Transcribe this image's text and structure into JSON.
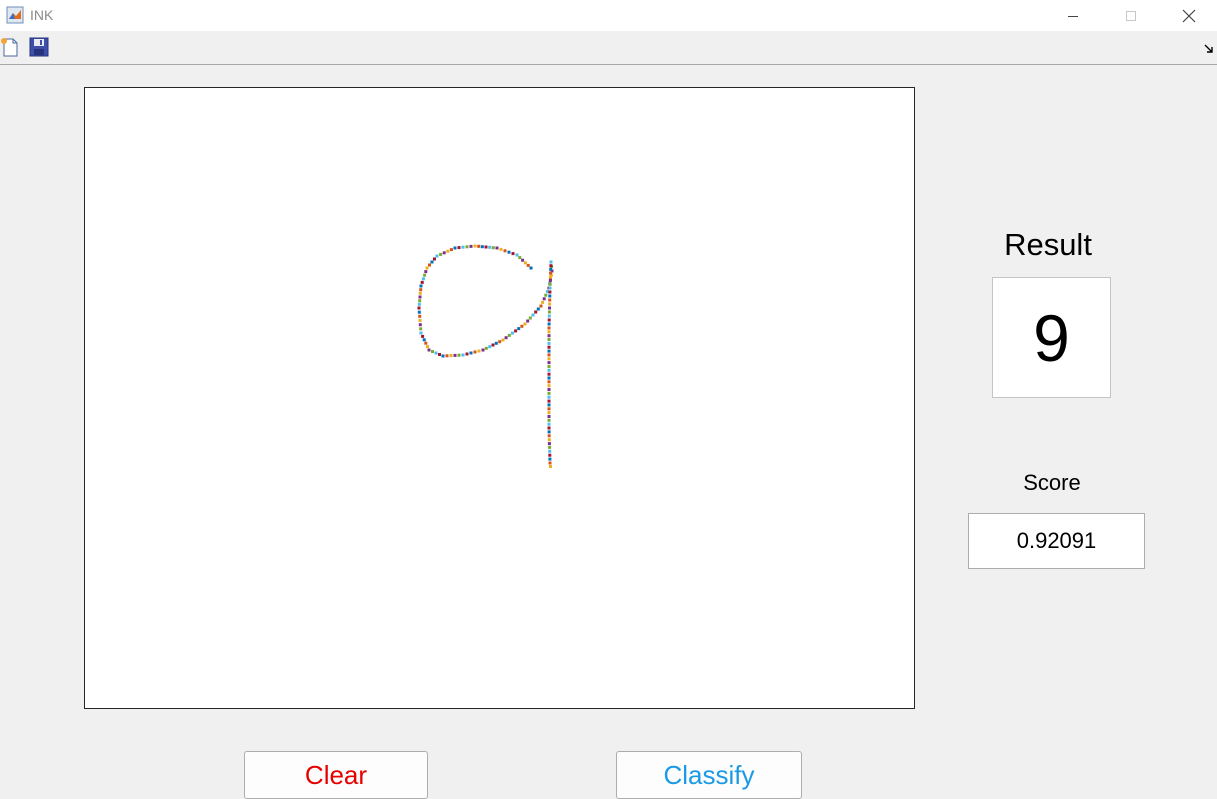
{
  "window": {
    "title": "INK",
    "app_icon": "matlab-icon",
    "controls": [
      "minimize-icon",
      "maximize-icon",
      "close-icon"
    ]
  },
  "toolbar": {
    "tools": [
      "new-figure-icon",
      "save-icon"
    ],
    "dock_control": "dock-arrow-icon"
  },
  "result": {
    "label": "Result",
    "value": "9"
  },
  "score": {
    "label": "Score",
    "value": "0.92091"
  },
  "buttons": {
    "clear_label": "Clear",
    "clear_color": "#e60000",
    "classify_label": "Classify",
    "classify_color": "#1a9ae6"
  },
  "drawing": {
    "description_icon": "handwritten-stroke",
    "marker_colors": [
      "#0072bd",
      "#d95319",
      "#edb120",
      "#7e2f8e",
      "#77ac30",
      "#4dbeee",
      "#a2142f"
    ]
  }
}
